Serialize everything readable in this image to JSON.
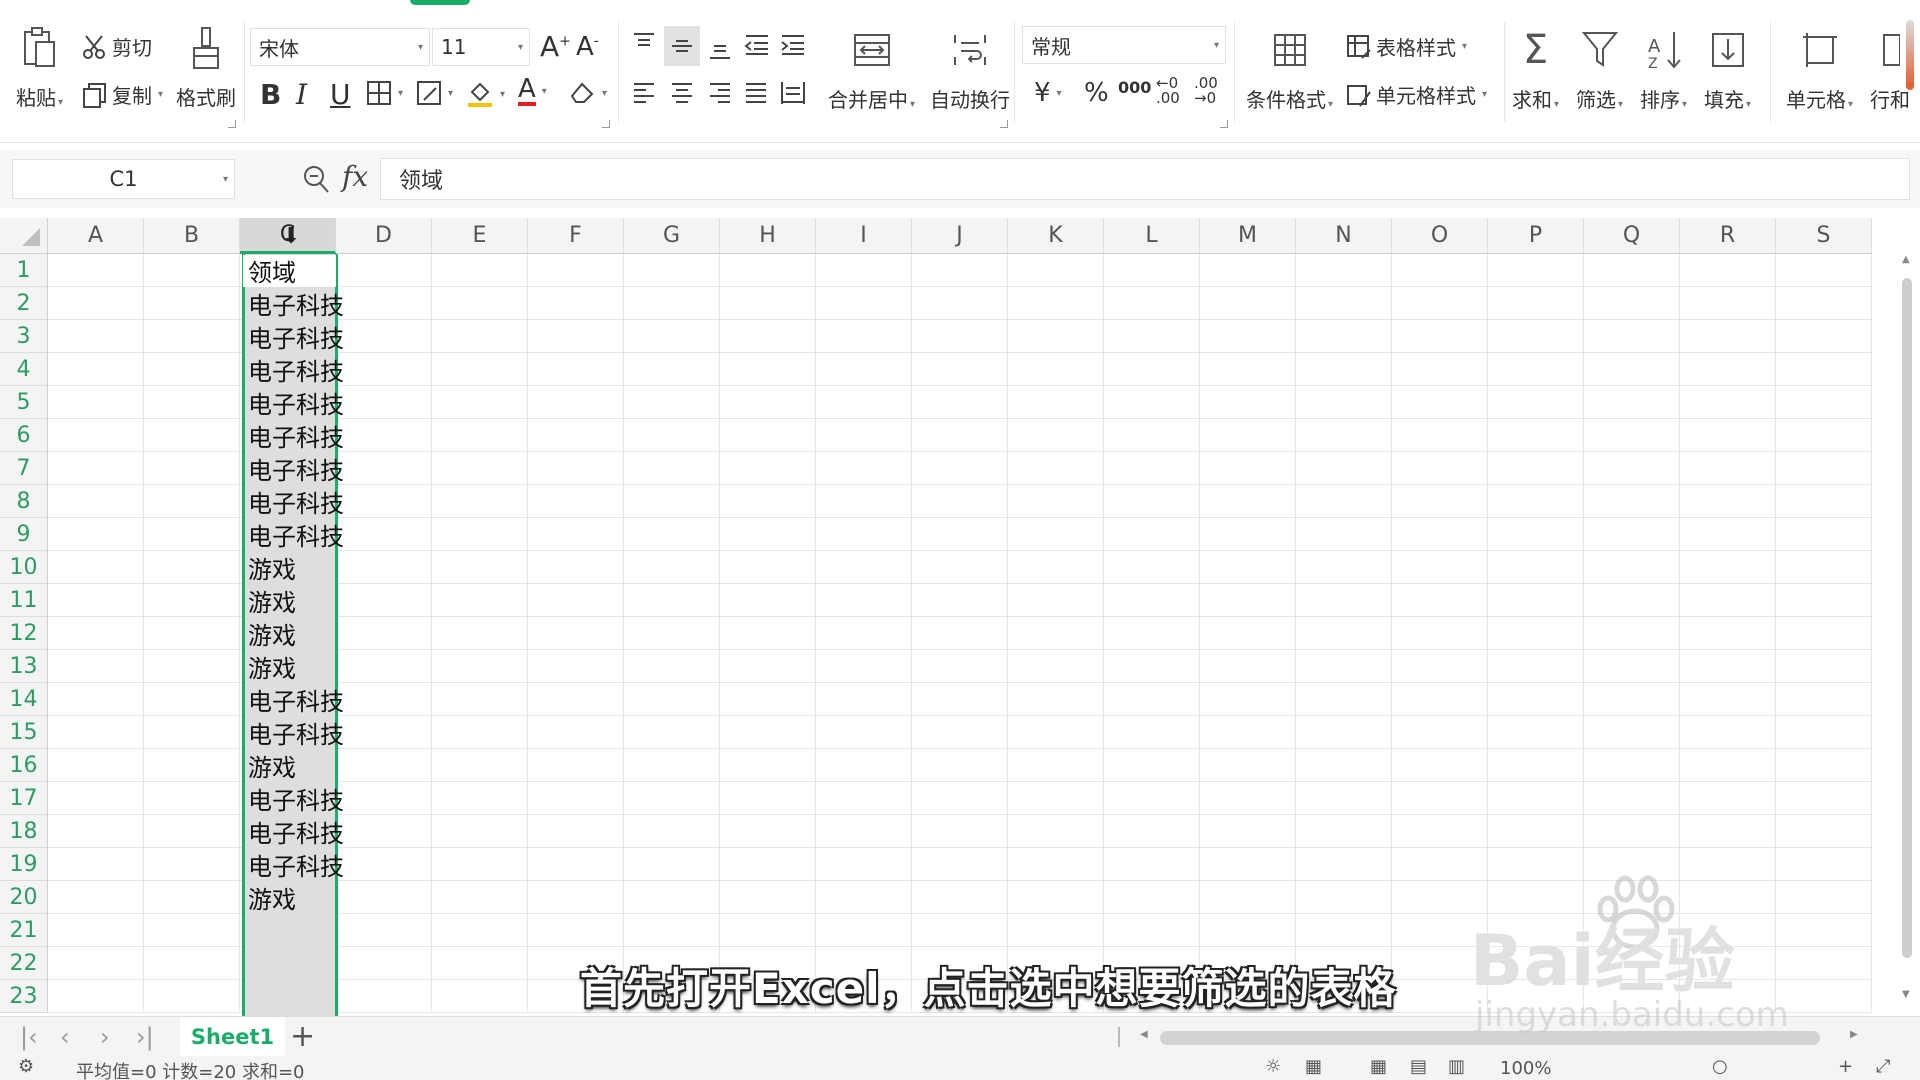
{
  "ribbon": {
    "paste": "粘贴",
    "cut": "剪切",
    "copy": "复制",
    "format_painter": "格式刷",
    "font_name": "宋体",
    "font_size": "11",
    "merge_center": "合并居中",
    "wrap_text": "自动换行",
    "number_format": "常规",
    "currency_symbol": "¥",
    "percent_symbol": "%",
    "thousands_symbol": "000",
    "conditional_format": "条件格式",
    "table_style": "表格样式",
    "cell_style": "单元格样式",
    "sum": "求和",
    "filter": "筛选",
    "sort": "排序",
    "fill": "填充",
    "cell": "单元格",
    "row_col": "行和",
    "accent_color": "#1aad6a"
  },
  "formula_bar": {
    "name_box": "C1",
    "fx_label": "fx",
    "content": "领域"
  },
  "grid": {
    "columns": [
      "A",
      "B",
      "C",
      "D",
      "E",
      "F",
      "G",
      "H",
      "I",
      "J",
      "K",
      "L",
      "M",
      "N",
      "O",
      "P",
      "Q",
      "R",
      "S"
    ],
    "rows": [
      "1",
      "2",
      "3",
      "4",
      "5",
      "6",
      "7",
      "8",
      "9",
      "10",
      "11",
      "12",
      "13",
      "14",
      "15",
      "16",
      "17",
      "18",
      "19",
      "20",
      "21",
      "22",
      "23"
    ],
    "selected_column": "C",
    "column_c_values": [
      "领域",
      "电子科技",
      "电子科技",
      "电子科技",
      "电子科技",
      "电子科技",
      "电子科技",
      "电子科技",
      "电子科技",
      "游戏",
      "游戏",
      "游戏",
      "游戏",
      "电子科技",
      "电子科技",
      "游戏",
      "电子科技",
      "电子科技",
      "电子科技",
      "游戏"
    ]
  },
  "sheets": {
    "active": "Sheet1",
    "add": "+"
  },
  "status": {
    "text": "平均值=0  计数=20  求和=0",
    "zoom": "100%"
  },
  "overlay": {
    "subtitle": "首先打开Excel，点击选中想要筛选的表格",
    "watermark_logo": "Bai经验",
    "watermark_url": "jingyan.baidu.com"
  }
}
